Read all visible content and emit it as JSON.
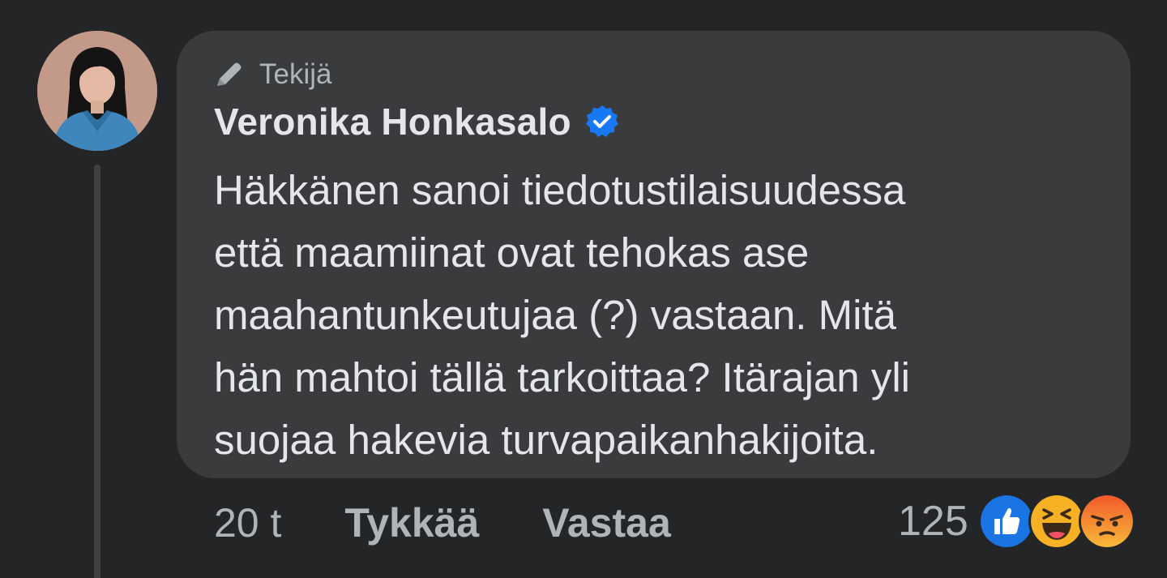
{
  "comment": {
    "author_badge": "Tekijä",
    "author_name": "Veronika Honkasalo",
    "text": "Häkkänen sanoi tiedotustilaisuudessa\nettä maamiinat ovat tehokas ase\nmaahantunkeutujaa (?) vastaan. Mitä\nhän mahtoi tällä tarkoittaa? Itärajan yli\nsuojaa hakevia turvapaikanhakijoita.",
    "timestamp": "20 t",
    "like_label": "Tykkää",
    "reply_label": "Vastaa",
    "reaction_count": "125",
    "reactions": [
      "like-icon",
      "haha-icon",
      "angry-icon"
    ]
  },
  "colors": {
    "background": "#242526",
    "bubble": "#3a3b3c",
    "primary_text": "#e4e6eb",
    "secondary_text": "#b0b3b8",
    "verified_blue": "#1877f2"
  }
}
